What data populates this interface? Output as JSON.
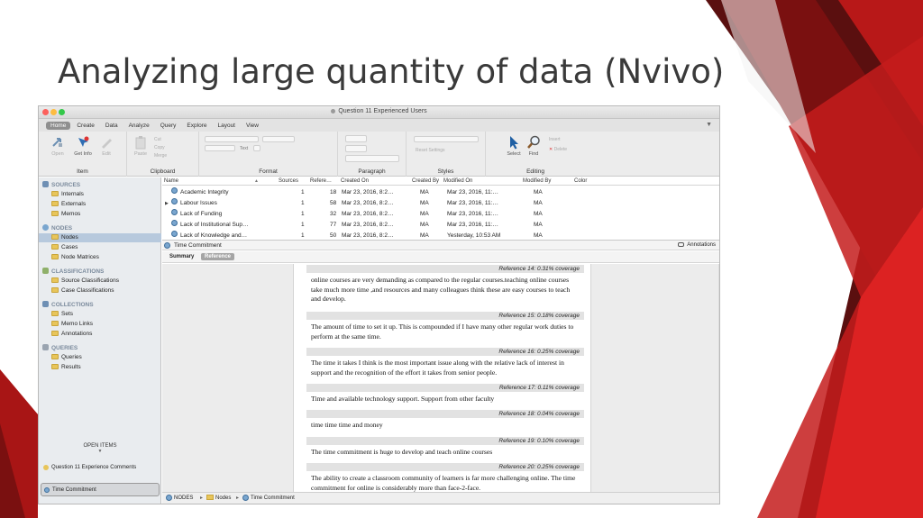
{
  "slide": {
    "title": "Analyzing large quantity of data (Nvivo)",
    "accent_colors": [
      "#7a1010",
      "#b81818",
      "#d62020",
      "#5a0f0f"
    ]
  },
  "window": {
    "title": "Question 11 Experienced Users"
  },
  "ribbon": {
    "tabs": [
      "Home",
      "Create",
      "Data",
      "Analyze",
      "Query",
      "Explore",
      "Layout",
      "View"
    ],
    "active_tab": "Home",
    "groups": {
      "item": {
        "label": "Item",
        "open": "Open",
        "get_info": "Get Info",
        "edit": "Edit"
      },
      "clipboard": {
        "label": "Clipboard",
        "paste": "Paste",
        "cut": "Cut",
        "copy": "Copy",
        "merge": "Merge"
      },
      "format": {
        "label": "Format",
        "text": "Text"
      },
      "paragraph": {
        "label": "Paragraph"
      },
      "styles": {
        "label": "Styles",
        "reset_settings": "Reset Settings"
      },
      "editing": {
        "label": "Editing",
        "select": "Select",
        "find": "Find",
        "insert": "Insert",
        "delete": "Delete"
      }
    }
  },
  "nav": {
    "sections": [
      {
        "title": "SOURCES",
        "items": [
          "Internals",
          "Externals",
          "Memos"
        ]
      },
      {
        "title": "NODES",
        "items": [
          "Nodes",
          "Cases",
          "Node Matrices"
        ]
      },
      {
        "title": "CLASSIFICATIONS",
        "items": [
          "Source Classifications",
          "Case Classifications"
        ]
      },
      {
        "title": "COLLECTIONS",
        "items": [
          "Sets",
          "Memo Links",
          "Annotations"
        ]
      },
      {
        "title": "QUERIES",
        "items": [
          "Queries",
          "Results"
        ]
      }
    ],
    "selected": "Nodes",
    "open_items_label": "OPEN ITEMS",
    "open_items": [
      "Question 11 Experience Comments",
      "Time Commitment"
    ]
  },
  "list": {
    "columns": [
      "Name",
      "Sources",
      "Refere…",
      "Created On",
      "Created By",
      "Modified On",
      "Modified By",
      "Color"
    ],
    "rows": [
      {
        "name": "Academic Integrity",
        "sources": "1",
        "references": "18",
        "created_on": "Mar 23, 2016, 8:2…",
        "created_by": "MA",
        "modified_on": "Mar 23, 2016, 11:…",
        "modified_by": "MA"
      },
      {
        "name": "Labour Issues",
        "sources": "1",
        "references": "58",
        "created_on": "Mar 23, 2016, 8:2…",
        "created_by": "MA",
        "modified_on": "Mar 23, 2016, 11:…",
        "modified_by": "MA"
      },
      {
        "name": "Lack of Funding",
        "sources": "1",
        "references": "32",
        "created_on": "Mar 23, 2016, 8:2…",
        "created_by": "MA",
        "modified_on": "Mar 23, 2016, 11:…",
        "modified_by": "MA"
      },
      {
        "name": "Lack of Institutional Sup…",
        "sources": "1",
        "references": "77",
        "created_on": "Mar 23, 2016, 8:2…",
        "created_by": "MA",
        "modified_on": "Mar 23, 2016, 11:…",
        "modified_by": "MA"
      },
      {
        "name": "Lack of Knowledge and…",
        "sources": "1",
        "references": "50",
        "created_on": "Mar 23, 2016, 8:2…",
        "created_by": "MA",
        "modified_on": "Yesterday, 10:53 AM",
        "modified_by": "MA"
      }
    ]
  },
  "detail": {
    "title": "Time Commitment",
    "annotations_label": "Annotations",
    "tabs": [
      "Summary",
      "Reference"
    ],
    "active_tab": "Reference",
    "references": [
      {
        "head": "Reference 14: 0.31% coverage",
        "text": "online courses are very demanding as compared to the regular courses.teaching online courses take much more time ,and resources and many colleagues think these are easy courses to teach and develop."
      },
      {
        "head": "Reference 15: 0.18% coverage",
        "text": "The amount of time to set it up.  This is compounded if I have many other regular work duties to perform at the same time."
      },
      {
        "head": "Reference 16: 0.25% coverage",
        "text": "The time it takes I think is the most important issue along with the relative lack of interest in support and the recognition of the effort it takes from senior people."
      },
      {
        "head": "Reference 17: 0.11% coverage",
        "text": "Time and available technology support.   Support from other faculty"
      },
      {
        "head": "Reference 18: 0.04% coverage",
        "text": "time time time and money"
      },
      {
        "head": "Reference 19: 0.10% coverage",
        "text": "The time commitment is huge to develop and teach online courses"
      },
      {
        "head": "Reference 20: 0.25% coverage",
        "text": "The ability to create a classroom community of learners is far more challenging online. The time commitment for online is considerably more than face-2-face."
      }
    ]
  },
  "breadcrumb": [
    "NODES",
    "Nodes",
    "Time Commitment"
  ]
}
